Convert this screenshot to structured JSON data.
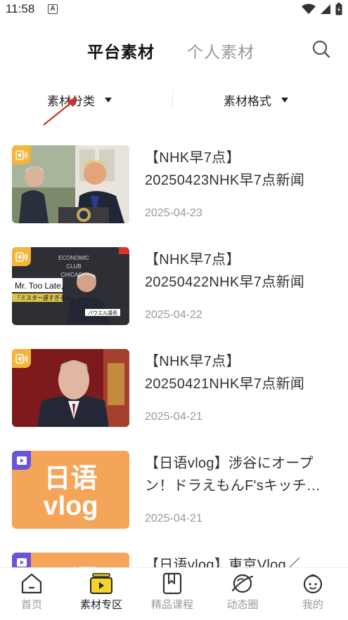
{
  "status_bar": {
    "time": "11:58",
    "notif_letter": "A"
  },
  "header": {
    "tabs": [
      {
        "label": "平台素材",
        "active": true
      },
      {
        "label": "个人素材",
        "active": false
      }
    ],
    "accent_color": "#f5d42a"
  },
  "filters": {
    "category_label": "素材分类",
    "format_label": "素材格式"
  },
  "items": [
    {
      "title_line1": "【NHK早7点】",
      "title_line2": "20250423NHK早7点新闻",
      "date": "2025-04-23",
      "badge": "audio-icon"
    },
    {
      "title_line1": "【NHK早7点】",
      "title_line2": "20250422NHK早7点新闻",
      "date": "2025-04-22",
      "badge": "audio-icon",
      "thumb_text1": "Mr. Too Late,",
      "thumb_text2": "「ミスター遅すぎる人」",
      "thumb_caption": "パウエル議長",
      "thumb_bg_lines": [
        "ECONOMIC",
        "CLUB",
        "CHICAGO"
      ]
    },
    {
      "title_line1": "【NHK早7点】",
      "title_line2": "20250421NHK早7点新闻",
      "date": "2025-04-21",
      "badge": "audio-icon"
    },
    {
      "title_line1": "【日语vlog】涉谷にオープ",
      "title_line2": "ン！ドラえもんF'sキッチ…",
      "date": "2025-04-21",
      "badge": "video-icon",
      "thumb_text1": "日语",
      "thumb_text2": "vlog"
    },
    {
      "title_line1": "【日语vlog】東京Vlog／",
      "title_line2": "",
      "date": "",
      "badge": "video-icon",
      "thumb_text1": "日语",
      "thumb_text2": ""
    }
  ],
  "bottom_nav": [
    {
      "label": "首页",
      "active": false
    },
    {
      "label": "素材专区",
      "active": true
    },
    {
      "label": "精品课程",
      "active": false
    },
    {
      "label": "动态圈",
      "active": false
    },
    {
      "label": "我的",
      "active": false
    }
  ]
}
